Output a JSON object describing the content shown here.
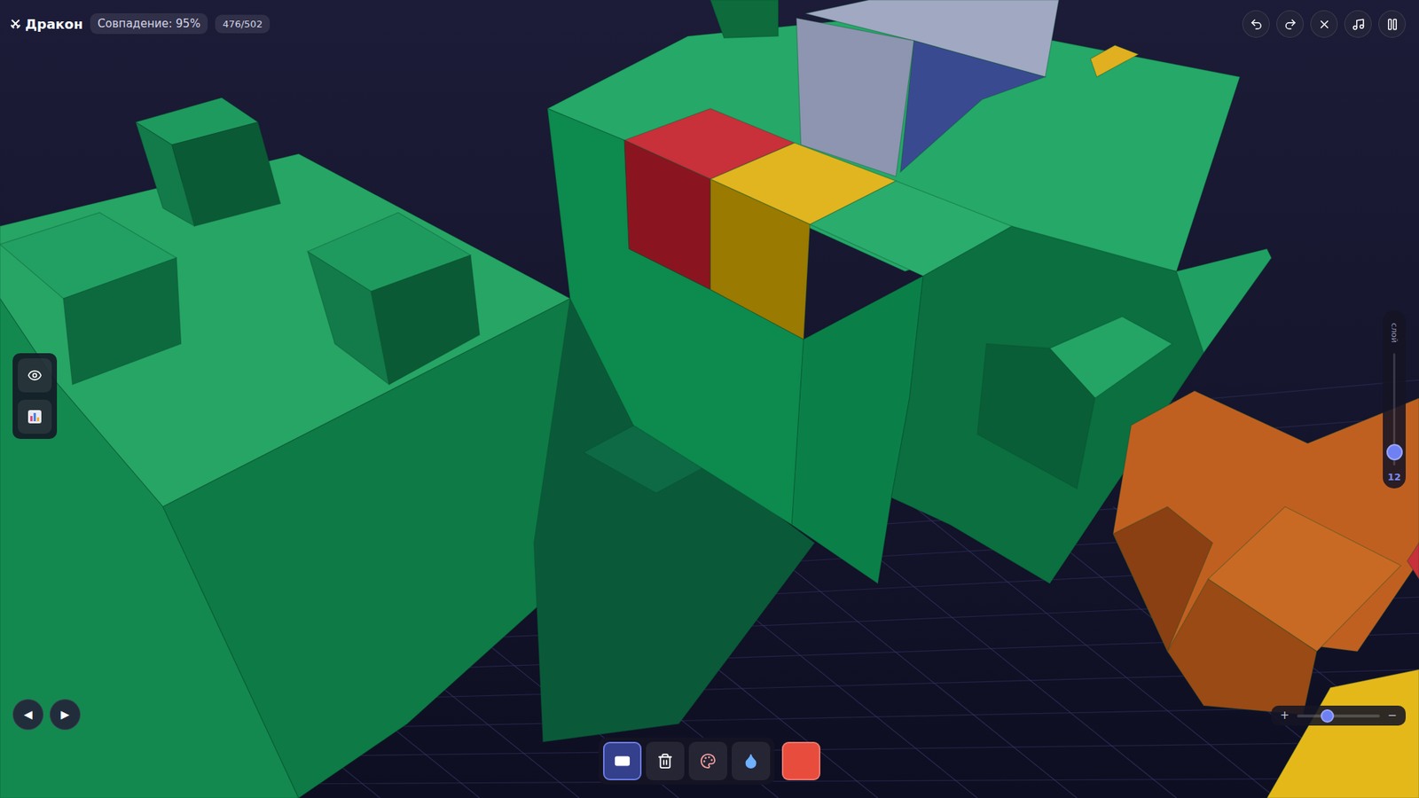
{
  "app": {
    "title": "Дракон",
    "match": "Совпадение: 95%",
    "progress": "476/502"
  },
  "top_buttons": [
    {
      "action": "undo"
    },
    {
      "action": "redo"
    },
    {
      "action": "close"
    },
    {
      "action": "music"
    },
    {
      "action": "pause"
    }
  ],
  "view_buttons": [
    {
      "action": "visibility"
    },
    {
      "action": "stats"
    }
  ],
  "navigation": [
    "◀",
    "▶"
  ],
  "tools": [
    {
      "action": "brush",
      "selected": true
    },
    {
      "action": "erase",
      "selected": false
    },
    {
      "action": "paint",
      "selected": false
    },
    {
      "action": "fill",
      "selected": false
    }
  ],
  "current_color": "#e84c3d",
  "layer_slider": {
    "label": "слой",
    "value": "12",
    "level": 0.12
  },
  "zoom_slider": {
    "plus": "+",
    "minus": "−",
    "level": 0.37
  }
}
